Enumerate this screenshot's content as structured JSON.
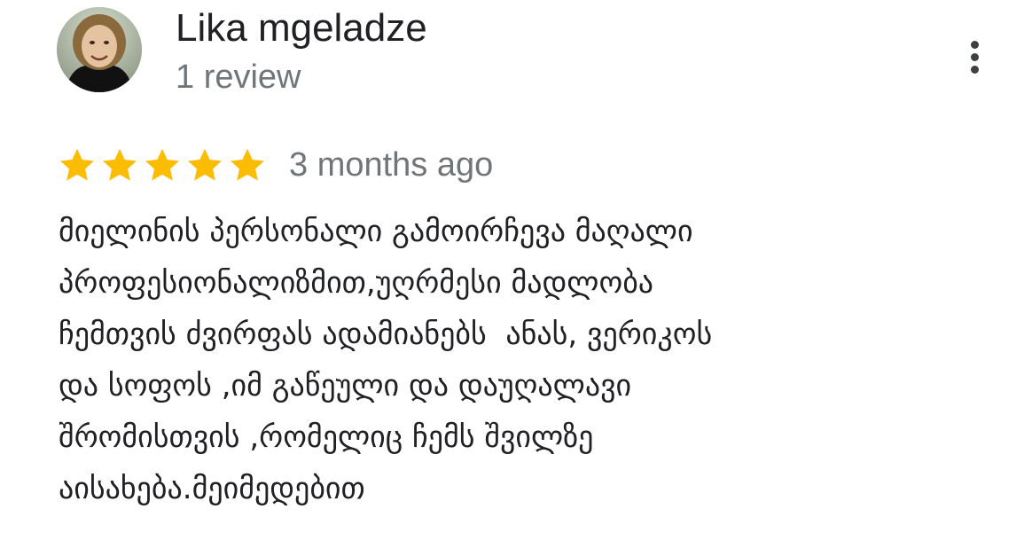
{
  "review": {
    "author": {
      "name": "Lika mgeladze",
      "review_count": "1 review",
      "avatar_icon": "profile-photo"
    },
    "rating": {
      "stars": 5,
      "max_stars": 5,
      "star_color": "#fbbc04"
    },
    "time_ago": "3 months ago",
    "text_lines": [
      "მიელინის პერსონალი გამოირჩევა მაღალი",
      "პროფესიონალიზმით,უღრმესი მადლობა",
      "ჩემთვის ძვირფას ადამიანებს  ანას, ვერიკოს",
      "და სოფოს ,იმ გაწეული და დაუღალავი",
      "შრომისთვის ,რომელიც ჩემს შვილზე",
      "აისახება.მეიმედებით"
    ],
    "menu_icon": "more-vert-icon"
  },
  "colors": {
    "text_primary": "#202124",
    "text_secondary": "#70757a",
    "star": "#fbbc04"
  }
}
